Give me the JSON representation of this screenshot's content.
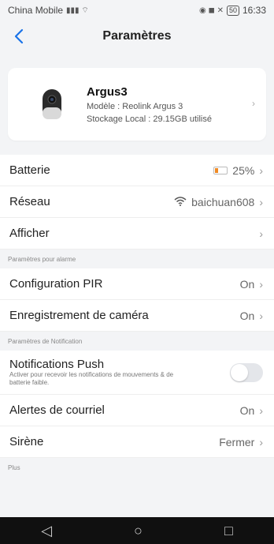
{
  "status": {
    "carrier": "China Mobile",
    "time": "16:33",
    "battery": "50"
  },
  "header": {
    "title": "Paramètres"
  },
  "device": {
    "name": "Argus3",
    "model": "Modèle : Reolink Argus 3",
    "storage": "Stockage Local : 29.15GB utilisé"
  },
  "rows": {
    "battery": {
      "label": "Batterie",
      "value": "25%"
    },
    "network": {
      "label": "Réseau",
      "value": "baichuan608"
    },
    "display": {
      "label": "Afficher"
    },
    "alarm_group": "Paramètres pour alarme",
    "pir": {
      "label": "Configuration PIR",
      "value": "On"
    },
    "recording": {
      "label": "Enregistrement de caméra",
      "value": "On"
    },
    "notif_group": "Paramètres de Notification",
    "push": {
      "label": "Notifications Push",
      "desc": "Activer pour recevoir les notifications de mouvements & de batterie faible."
    },
    "email": {
      "label": "Alertes de courriel",
      "value": "On"
    },
    "siren": {
      "label": "Sirène",
      "value": "Fermer"
    },
    "more_group": "Plus"
  },
  "colors": {
    "accent": "#1a73e8",
    "battery_low": "#f08a24",
    "background": "#f3f4f6"
  }
}
